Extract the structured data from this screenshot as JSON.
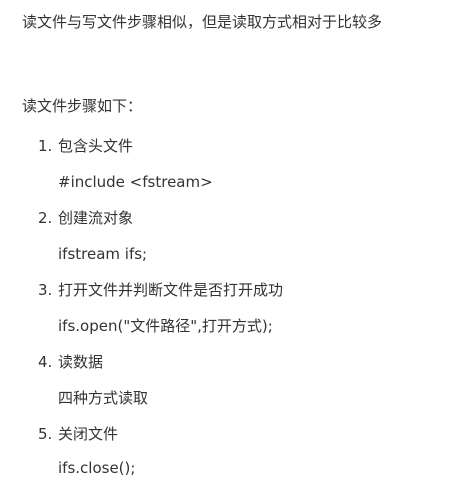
{
  "intro": "读文件与写文件步骤相似，但是读取方式相对于比较多",
  "heading": "读文件步骤如下：",
  "steps": [
    {
      "num": "1.",
      "title": "包含头文件",
      "detail": "#include <fstream>"
    },
    {
      "num": "2.",
      "title": "创建流对象",
      "detail": "ifstream ifs;"
    },
    {
      "num": "3.",
      "title": "打开文件并判断文件是否打开成功",
      "detail": "ifs.open(\"文件路径\",打开方式);"
    },
    {
      "num": "4.",
      "title": "读数据",
      "detail": "四种方式读取"
    },
    {
      "num": "5.",
      "title": "关闭文件",
      "detail": "ifs.close();"
    }
  ]
}
